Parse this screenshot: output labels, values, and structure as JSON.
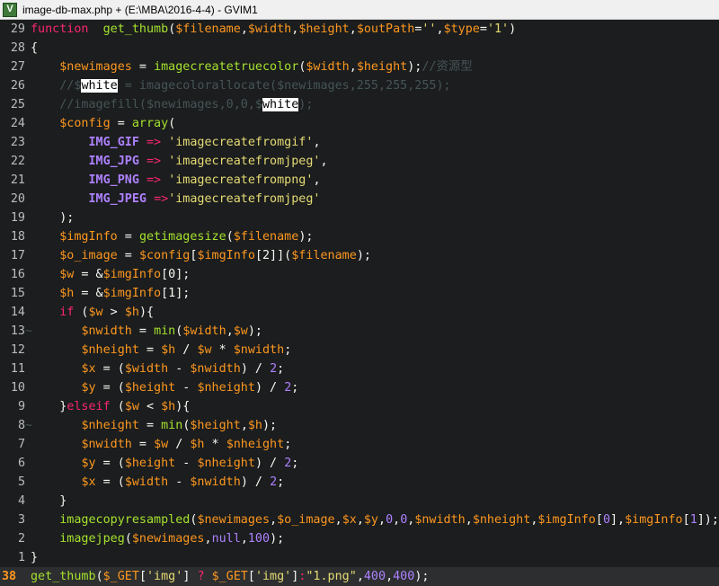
{
  "window": {
    "title": "image-db-max.php + (E:\\MBA\\2016-4-4) - GVIM1",
    "icon": "vim-icon"
  },
  "editor": {
    "current_line": "38",
    "lines": [
      {
        "num": "29",
        "sign": "",
        "tokens": [
          [
            "kw",
            "function"
          ],
          [
            "",
            "  "
          ],
          [
            "fn",
            "get_thumb"
          ],
          [
            "",
            "("
          ],
          [
            "var",
            "$filename"
          ],
          [
            "",
            ","
          ],
          [
            "var",
            "$width"
          ],
          [
            "",
            ","
          ],
          [
            "var",
            "$height"
          ],
          [
            "",
            ","
          ],
          [
            "var",
            "$outPath"
          ],
          [
            "",
            "="
          ],
          [
            "str",
            "''"
          ],
          [
            "",
            ","
          ],
          [
            "var",
            "$type"
          ],
          [
            "",
            "="
          ],
          [
            "str",
            "'1'"
          ],
          [
            "",
            ")"
          ]
        ]
      },
      {
        "num": "28",
        "sign": "",
        "tokens": [
          [
            "",
            "{"
          ]
        ]
      },
      {
        "num": "27",
        "sign": "",
        "tokens": [
          [
            "",
            "    "
          ],
          [
            "var",
            "$newimages"
          ],
          [
            "",
            " = "
          ],
          [
            "fn",
            "imagecreatetruecolor"
          ],
          [
            "",
            "("
          ],
          [
            "var",
            "$width"
          ],
          [
            "",
            ","
          ],
          [
            "var",
            "$height"
          ],
          [
            "",
            ");"
          ],
          [
            "cm",
            "//资源型"
          ]
        ]
      },
      {
        "num": "26",
        "sign": "",
        "tokens": [
          [
            "",
            "    "
          ],
          [
            "cm",
            "//$"
          ],
          [
            "hl",
            "white"
          ],
          [
            "cm",
            " = imagecolorallocate($newimages,255,255,255);"
          ]
        ]
      },
      {
        "num": "25",
        "sign": "",
        "tokens": [
          [
            "",
            "    "
          ],
          [
            "cm",
            "//imagefill($newimages,0,0,$"
          ],
          [
            "hl",
            "white"
          ],
          [
            "cm",
            ");"
          ]
        ]
      },
      {
        "num": "24",
        "sign": "",
        "tokens": [
          [
            "",
            "    "
          ],
          [
            "var",
            "$config"
          ],
          [
            "",
            " = "
          ],
          [
            "fn",
            "array"
          ],
          [
            "",
            "("
          ]
        ]
      },
      {
        "num": "23",
        "sign": "",
        "tokens": [
          [
            "",
            "        "
          ],
          [
            "const",
            "IMG_GIF"
          ],
          [
            "",
            " "
          ],
          [
            "kw",
            "=>"
          ],
          [
            "",
            " "
          ],
          [
            "str",
            "'imagecreatefromgif'"
          ],
          [
            "",
            ","
          ]
        ]
      },
      {
        "num": "22",
        "sign": "",
        "tokens": [
          [
            "",
            "        "
          ],
          [
            "const",
            "IMG_JPG"
          ],
          [
            "",
            " "
          ],
          [
            "kw",
            "=>"
          ],
          [
            "",
            " "
          ],
          [
            "str",
            "'imagecreatefromjpeg'"
          ],
          [
            "",
            ","
          ]
        ]
      },
      {
        "num": "21",
        "sign": "",
        "tokens": [
          [
            "",
            "        "
          ],
          [
            "const",
            "IMG_PNG"
          ],
          [
            "",
            " "
          ],
          [
            "kw",
            "=>"
          ],
          [
            "",
            " "
          ],
          [
            "str",
            "'imagecreatefrompng'"
          ],
          [
            "",
            ","
          ]
        ]
      },
      {
        "num": "20",
        "sign": "",
        "tokens": [
          [
            "",
            "        "
          ],
          [
            "const",
            "IMG_JPEG"
          ],
          [
            "",
            " "
          ],
          [
            "kw",
            "=>"
          ],
          [
            "str",
            "'imagecreatefromjpeg'"
          ]
        ]
      },
      {
        "num": "19",
        "sign": "",
        "tokens": [
          [
            "",
            "    "
          ],
          [
            "",
            ");"
          ]
        ]
      },
      {
        "num": "18",
        "sign": "",
        "tokens": [
          [
            "",
            "    "
          ],
          [
            "var",
            "$imgInfo"
          ],
          [
            "",
            " = "
          ],
          [
            "fn",
            "getimagesize"
          ],
          [
            "",
            "("
          ],
          [
            "var",
            "$filename"
          ],
          [
            "",
            ");"
          ]
        ]
      },
      {
        "num": "17",
        "sign": "",
        "tokens": [
          [
            "",
            "    "
          ],
          [
            "var",
            "$o_image"
          ],
          [
            "",
            " = "
          ],
          [
            "var",
            "$config"
          ],
          [
            "",
            "["
          ],
          [
            "var",
            "$imgInfo"
          ],
          [
            "",
            "[2]]("
          ],
          [
            "var",
            "$filename"
          ],
          [
            "",
            ");"
          ]
        ]
      },
      {
        "num": "16",
        "sign": "",
        "tokens": [
          [
            "",
            "    "
          ],
          [
            "var",
            "$w"
          ],
          [
            "",
            " = &"
          ],
          [
            "var",
            "$imgInfo"
          ],
          [
            "",
            "[0];"
          ]
        ]
      },
      {
        "num": "15",
        "sign": "",
        "tokens": [
          [
            "",
            "    "
          ],
          [
            "var",
            "$h"
          ],
          [
            "",
            " = &"
          ],
          [
            "var",
            "$imgInfo"
          ],
          [
            "",
            "[1];"
          ]
        ]
      },
      {
        "num": "14",
        "sign": "",
        "tokens": [
          [
            "",
            "    "
          ],
          [
            "kw",
            "if"
          ],
          [
            "",
            " ("
          ],
          [
            "var",
            "$w"
          ],
          [
            "",
            " > "
          ],
          [
            "var",
            "$h"
          ],
          [
            "",
            "){"
          ]
        ]
      },
      {
        "num": "13",
        "sign": "~",
        "tokens": [
          [
            "",
            "       "
          ],
          [
            "var",
            "$nwidth"
          ],
          [
            "",
            " = "
          ],
          [
            "fn",
            "min"
          ],
          [
            "",
            "("
          ],
          [
            "var",
            "$width"
          ],
          [
            "",
            ","
          ],
          [
            "var",
            "$w"
          ],
          [
            "",
            ");"
          ]
        ]
      },
      {
        "num": "12",
        "sign": "",
        "tokens": [
          [
            "",
            "       "
          ],
          [
            "var",
            "$nheight"
          ],
          [
            "",
            " = "
          ],
          [
            "var",
            "$h"
          ],
          [
            "",
            " / "
          ],
          [
            "var",
            "$w"
          ],
          [
            "",
            " * "
          ],
          [
            "var",
            "$nwidth"
          ],
          [
            "",
            ";"
          ]
        ]
      },
      {
        "num": "11",
        "sign": "",
        "tokens": [
          [
            "",
            "       "
          ],
          [
            "var",
            "$x"
          ],
          [
            "",
            " = ("
          ],
          [
            "var",
            "$width"
          ],
          [
            "",
            " - "
          ],
          [
            "var",
            "$nwidth"
          ],
          [
            "",
            ") / "
          ],
          [
            "num",
            "2"
          ],
          [
            "",
            ";"
          ]
        ]
      },
      {
        "num": "10",
        "sign": "",
        "tokens": [
          [
            "",
            "       "
          ],
          [
            "var",
            "$y"
          ],
          [
            "",
            " = ("
          ],
          [
            "var",
            "$height"
          ],
          [
            "",
            " - "
          ],
          [
            "var",
            "$nheight"
          ],
          [
            "",
            ") / "
          ],
          [
            "num",
            "2"
          ],
          [
            "",
            ";"
          ]
        ]
      },
      {
        "num": "9",
        "sign": "",
        "tokens": [
          [
            "",
            "    "
          ],
          [
            "",
            "}"
          ],
          [
            "kw",
            "elseif"
          ],
          [
            "",
            " ("
          ],
          [
            "var",
            "$w"
          ],
          [
            "",
            " < "
          ],
          [
            "var",
            "$h"
          ],
          [
            "",
            "){"
          ]
        ]
      },
      {
        "num": "8",
        "sign": "~",
        "tokens": [
          [
            "",
            "       "
          ],
          [
            "var",
            "$nheight"
          ],
          [
            "",
            " = "
          ],
          [
            "fn",
            "min"
          ],
          [
            "",
            "("
          ],
          [
            "var",
            "$height"
          ],
          [
            "",
            ","
          ],
          [
            "var",
            "$h"
          ],
          [
            "",
            ");"
          ]
        ]
      },
      {
        "num": "7",
        "sign": "",
        "tokens": [
          [
            "",
            "       "
          ],
          [
            "var",
            "$nwidth"
          ],
          [
            "",
            " = "
          ],
          [
            "var",
            "$w"
          ],
          [
            "",
            " / "
          ],
          [
            "var",
            "$h"
          ],
          [
            "",
            " * "
          ],
          [
            "var",
            "$nheight"
          ],
          [
            "",
            ";"
          ]
        ]
      },
      {
        "num": "6",
        "sign": "",
        "tokens": [
          [
            "",
            "       "
          ],
          [
            "var",
            "$y"
          ],
          [
            "",
            " = ("
          ],
          [
            "var",
            "$height"
          ],
          [
            "",
            " - "
          ],
          [
            "var",
            "$nheight"
          ],
          [
            "",
            ") / "
          ],
          [
            "num",
            "2"
          ],
          [
            "",
            ";"
          ]
        ]
      },
      {
        "num": "5",
        "sign": "",
        "tokens": [
          [
            "",
            "       "
          ],
          [
            "var",
            "$x"
          ],
          [
            "",
            " = ("
          ],
          [
            "var",
            "$width"
          ],
          [
            "",
            " - "
          ],
          [
            "var",
            "$nwidth"
          ],
          [
            "",
            ") / "
          ],
          [
            "num",
            "2"
          ],
          [
            "",
            ";"
          ]
        ]
      },
      {
        "num": "4",
        "sign": "",
        "tokens": [
          [
            "",
            "    "
          ],
          [
            "",
            "}"
          ]
        ]
      },
      {
        "num": "3",
        "sign": "",
        "tokens": [
          [
            "",
            "    "
          ],
          [
            "fn",
            "imagecopyresampled"
          ],
          [
            "",
            "("
          ],
          [
            "var",
            "$newimages"
          ],
          [
            "",
            ","
          ],
          [
            "var",
            "$o_image"
          ],
          [
            "",
            ","
          ],
          [
            "var",
            "$x"
          ],
          [
            "",
            ","
          ],
          [
            "var",
            "$y"
          ],
          [
            "",
            ","
          ],
          [
            "num",
            "0"
          ],
          [
            "",
            ","
          ],
          [
            "num",
            "0"
          ],
          [
            "",
            ","
          ],
          [
            "var",
            "$nwidth"
          ],
          [
            "",
            ","
          ],
          [
            "var",
            "$nheight"
          ],
          [
            "",
            ","
          ],
          [
            "var",
            "$imgInfo"
          ],
          [
            "",
            "["
          ],
          [
            "num",
            "0"
          ],
          [
            "",
            "],"
          ],
          [
            "var",
            "$imgInfo"
          ],
          [
            "",
            "["
          ],
          [
            "num",
            "1"
          ],
          [
            "",
            "]);"
          ]
        ]
      },
      {
        "num": "2",
        "sign": "",
        "tokens": [
          [
            "",
            "    "
          ],
          [
            "fn",
            "imagejpeg"
          ],
          [
            "",
            "("
          ],
          [
            "var",
            "$newimages"
          ],
          [
            "",
            ","
          ],
          [
            "num",
            "null"
          ],
          [
            "",
            ","
          ],
          [
            "num",
            "100"
          ],
          [
            "",
            ");"
          ]
        ]
      },
      {
        "num": "1",
        "sign": "",
        "tokens": [
          [
            "",
            "}"
          ]
        ]
      },
      {
        "num": "38",
        "sign": "",
        "cursor": true,
        "tokens": [
          [
            "fn",
            "get_thumb"
          ],
          [
            "",
            "("
          ],
          [
            "var",
            "$_GET"
          ],
          [
            "",
            "["
          ],
          [
            "str",
            "'img'"
          ],
          [
            "",
            "] "
          ],
          [
            "kw",
            "?"
          ],
          [
            "",
            " "
          ],
          [
            "var",
            "$_GET"
          ],
          [
            "",
            "["
          ],
          [
            "str",
            "'img'"
          ],
          [
            "",
            "]"
          ],
          [
            "kw",
            ":"
          ],
          [
            "str",
            "\"1.png\""
          ],
          [
            "",
            ","
          ],
          [
            "num",
            "400"
          ],
          [
            "",
            ","
          ],
          [
            "num",
            "400"
          ],
          [
            "",
            ");"
          ]
        ]
      }
    ]
  },
  "colors": {
    "background": "#1b1d1e",
    "keyword": "#f92672",
    "function": "#a6e22e",
    "variable": "#fd971f",
    "string": "#e6db74",
    "number": "#ae81ff",
    "comment": "#465457",
    "line_number": "#bcbcbc",
    "current_line_number": "#fd971f"
  }
}
